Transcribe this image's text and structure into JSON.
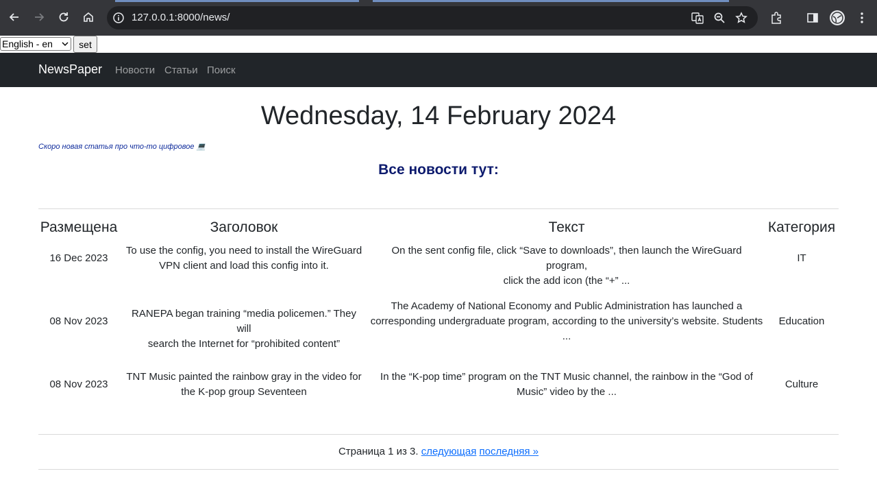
{
  "browser": {
    "url": "127.0.0.1:8000/news/"
  },
  "lang_bar": {
    "selected_language": "English - en",
    "set_label": "set"
  },
  "navbar": {
    "brand": "NewsPaper",
    "links": [
      "Новости",
      "Статьи",
      "Поиск"
    ]
  },
  "page": {
    "date": "Wednesday, 14 February 2024",
    "notice": "Скоро новая статья про что-то цифровое 💻",
    "subheading": "Все новости тут:"
  },
  "table": {
    "headers": [
      "Размещена",
      "Заголовок",
      "Текст",
      "Категория"
    ],
    "rows": [
      {
        "date": "16 Dec 2023",
        "title_lines": [
          "To use the config, you need to install the WireGuard",
          "VPN client and load this config into it."
        ],
        "text_lines": [
          "On the sent config file, click “Save to downloads”, then launch the WireGuard program,",
          "click the add icon (the “+” ..."
        ],
        "category": "IT"
      },
      {
        "date": "08 Nov 2023",
        "title_lines": [
          "RANEPA began training “media policemen.” They will",
          "search the Internet for “prohibited content”"
        ],
        "text_lines": [
          "The Academy of National Economy and Public Administration has launched a",
          "corresponding undergraduate program, according to the university’s website. Students",
          "..."
        ],
        "category": "Education"
      },
      {
        "date": "08 Nov 2023",
        "title_lines": [
          "TNT Music painted the rainbow gray in the video for",
          "the K-pop group Seventeen"
        ],
        "text_lines": [
          "In the “K-pop time” program on the TNT Music channel, the rainbow in the “God of",
          "Music” video by the ..."
        ],
        "category": "Culture"
      }
    ]
  },
  "pagination": {
    "status": "Страница 1 из 3.",
    "next_label": "следующая",
    "last_label": "последняя »"
  }
}
